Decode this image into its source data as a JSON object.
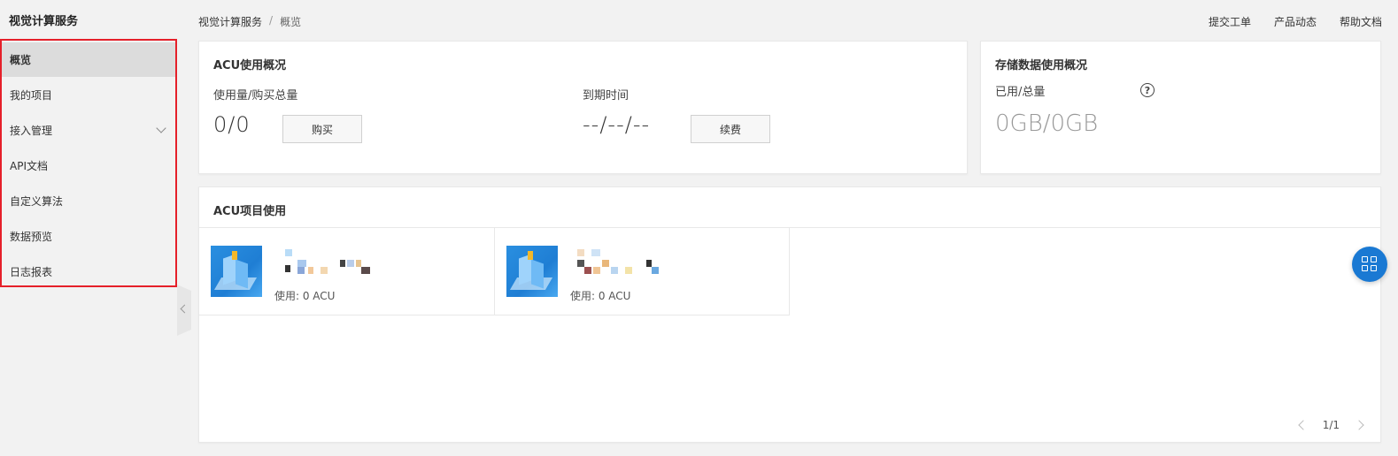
{
  "sidebar": {
    "title": "视觉计算服务",
    "items": [
      {
        "label": "概览",
        "active": true
      },
      {
        "label": "我的项目"
      },
      {
        "label": "接入管理",
        "has_submenu": true
      },
      {
        "label": "API文档"
      },
      {
        "label": "自定义算法"
      },
      {
        "label": "数据预览"
      },
      {
        "label": "日志报表"
      }
    ]
  },
  "header": {
    "breadcrumb": {
      "root": "视觉计算服务",
      "separator": "/",
      "current": "概览"
    },
    "links": [
      "提交工单",
      "产品动态",
      "帮助文档"
    ]
  },
  "acu_overview": {
    "title": "ACU使用概况",
    "usage_label": "使用量/购买总量",
    "usage_value": "0/0",
    "buy_label": "购买",
    "expiry_label": "到期时间",
    "expiry_value": "--/--/--",
    "renew_label": "续费"
  },
  "storage_overview": {
    "title": "存储数据使用概况",
    "used_label": "已用/总量",
    "help_icon": "question-circle-icon",
    "value": "0GB/0GB"
  },
  "acu_projects": {
    "title": "ACU项目使用",
    "projects": [
      {
        "usage": "使用: 0 ACU"
      },
      {
        "usage": "使用: 0 ACU"
      }
    ],
    "pager": {
      "text": "1/1"
    }
  },
  "float_button": {
    "icon": "grid-apps-icon"
  },
  "colors": {
    "accent": "#1a79d3",
    "highlight_border": "#e5202a"
  }
}
